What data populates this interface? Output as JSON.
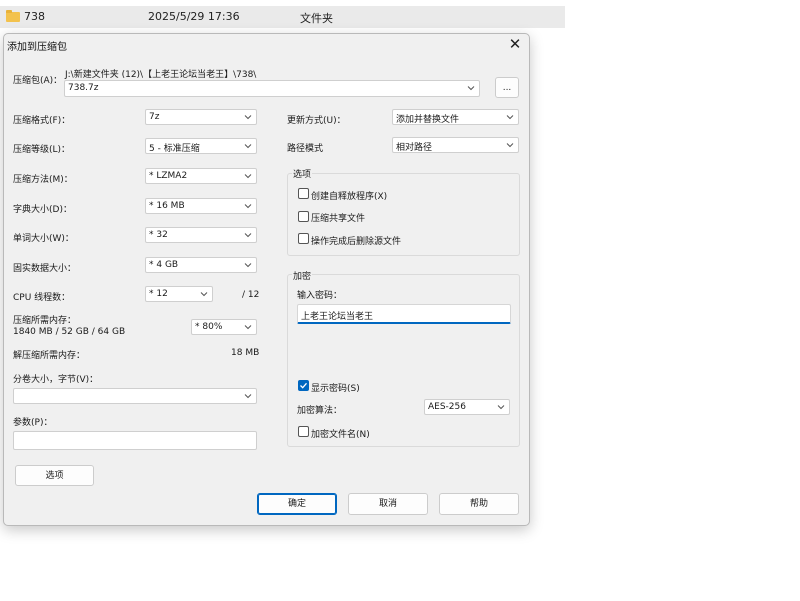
{
  "explorer": {
    "name": "738",
    "date": "2025/5/29 17:36",
    "type": "文件夹"
  },
  "dialog": {
    "title": "添加到压缩包",
    "archive": {
      "label": "压缩包(A)：",
      "path": "J:\\新建文件夹 (12)\\【上老王论坛当老王】\\738\\",
      "value": "738.7z",
      "browse_label": "..."
    },
    "left": {
      "format": {
        "label": "压缩格式(F)：",
        "value": "7z"
      },
      "level": {
        "label": "压缩等级(L)：",
        "value": "5 - 标准压缩"
      },
      "method": {
        "label": "压缩方法(M)：",
        "value": "* LZMA2"
      },
      "dict": {
        "label": "字典大小(D)：",
        "value": "* 16 MB"
      },
      "word": {
        "label": "单词大小(W)：",
        "value": "* 32"
      },
      "solid": {
        "label": "固实数据大小：",
        "value": "* 4 GB"
      },
      "cpu": {
        "label": "CPU 线程数：",
        "value": "* 12",
        "total": "/ 12"
      },
      "mem_compress": {
        "label": "压缩所需内存：",
        "detail": "1840 MB / 52 GB / 64 GB",
        "value": "* 80%"
      },
      "mem_decompress": {
        "label": "解压缩所需内存：",
        "value": "18 MB"
      },
      "split": {
        "label": "分卷大小，字节(V)：",
        "value": ""
      },
      "params": {
        "label": "参数(P)：",
        "value": ""
      },
      "options_button": "选项"
    },
    "right": {
      "update": {
        "label": "更新方式(U)：",
        "value": "添加并替换文件"
      },
      "path_mode": {
        "label": "路径模式",
        "value": "相对路径"
      },
      "options": {
        "legend": "选项",
        "sfx": "创建自释放程序(X)",
        "shared": "压缩共享文件",
        "delete": "操作完成后删除源文件"
      },
      "encryption": {
        "legend": "加密",
        "password_label": "输入密码：",
        "password_value": "上老王论坛当老王",
        "show_password": "显示密码(S)",
        "method_label": "加密算法：",
        "method_value": "AES-256",
        "encrypt_names": "加密文件名(N)"
      }
    },
    "buttons": {
      "ok": "确定",
      "cancel": "取消",
      "help": "帮助"
    }
  }
}
